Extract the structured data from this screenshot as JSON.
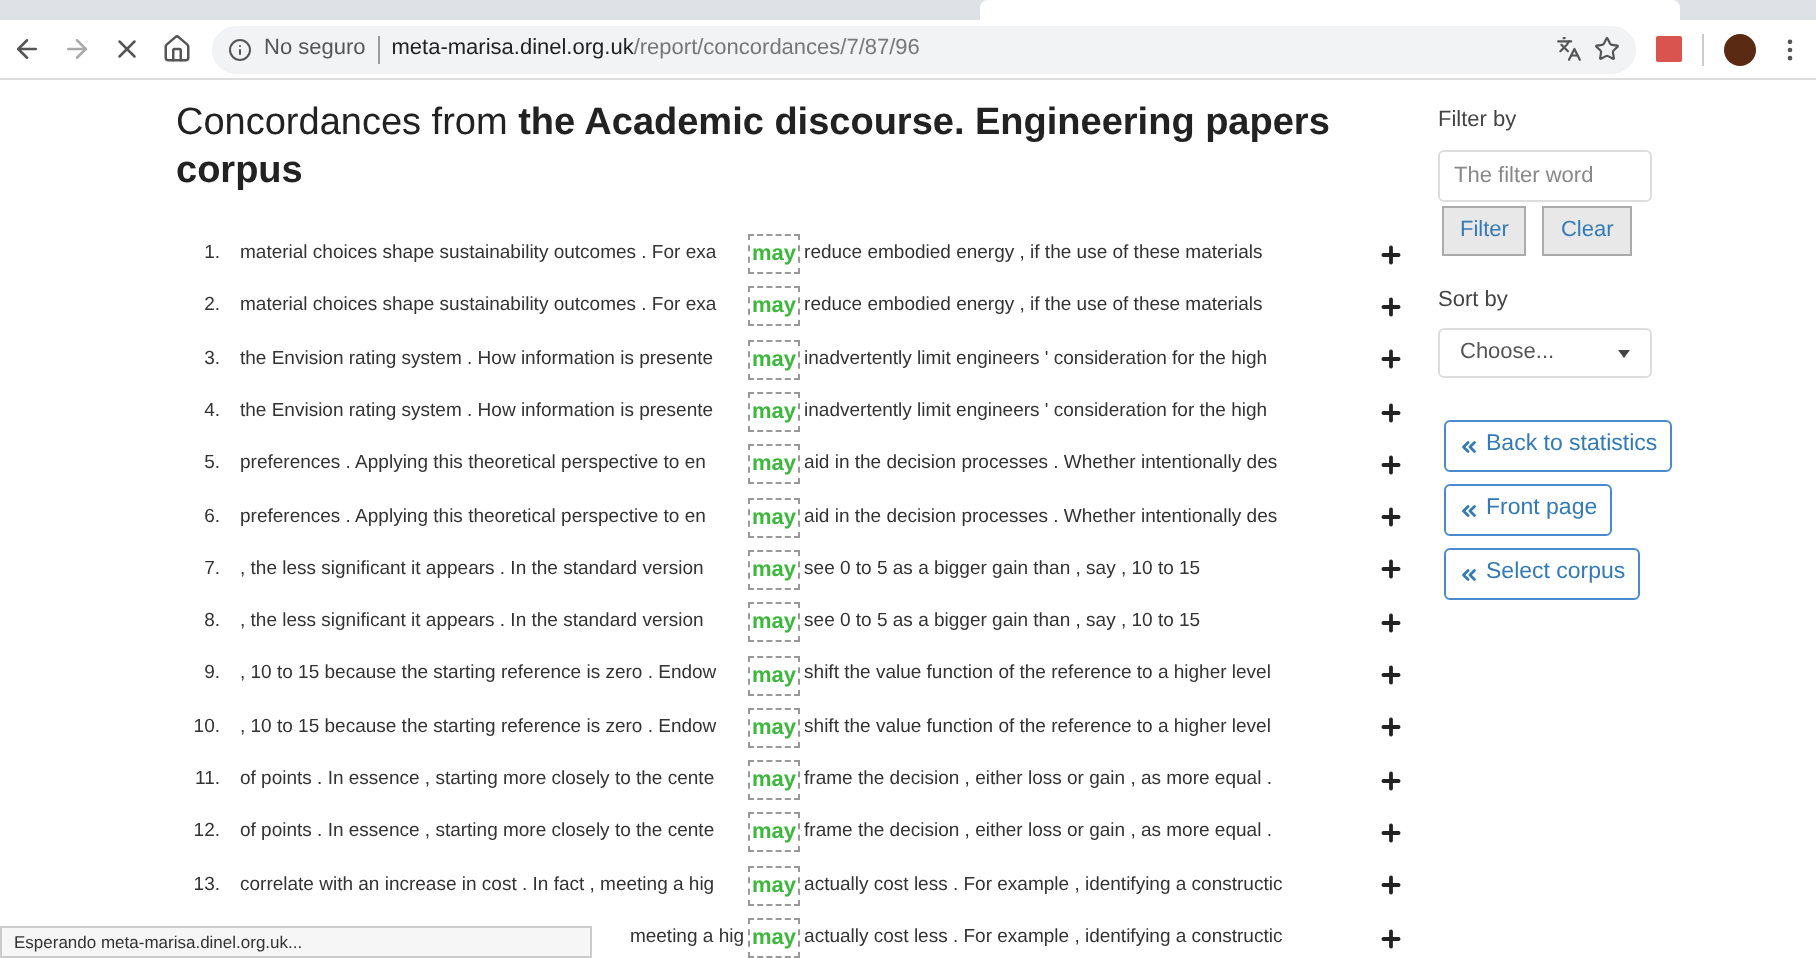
{
  "browser": {
    "security": "No seguro",
    "url_domain": "meta-marisa.dinel.org.uk",
    "url_path": "/report/concordances/7/87/96"
  },
  "title": "Concordances from **the Academic discourse. Engineering papers corpus**",
  "rows": [
    {
      "number": "1.",
      "left": "material choices shape sustainability outcomes . For exa",
      "keyword": "may",
      "right": "reduce embodied energy , if the use of these materials"
    },
    {
      "number": "2.",
      "left": "material choices shape sustainability outcomes . For exa",
      "keyword": "may",
      "right": "reduce embodied energy , if the use of these materials"
    },
    {
      "number": "3.",
      "left": "the Envision rating system . How information is presente",
      "keyword": "may",
      "right": "inadvertently limit engineers ' consideration for the high"
    },
    {
      "number": "4.",
      "left": "the Envision rating system . How information is presente",
      "keyword": "may",
      "right": "inadvertently limit engineers ' consideration for the high"
    },
    {
      "number": "5.",
      "left": "preferences . Applying this theoretical perspective to en",
      "keyword": "may",
      "right": "aid in the decision processes . Whether intentionally des"
    },
    {
      "number": "6.",
      "left": "preferences . Applying this theoretical perspective to en",
      "keyword": "may",
      "right": "aid in the decision processes . Whether intentionally des"
    },
    {
      "number": "7.",
      "left": ", the less significant it appears . In the standard version",
      "keyword": "may",
      "right": "see 0 to 5 as a bigger gain than , say , 10 to 15"
    },
    {
      "number": "8.",
      "left": ", the less significant it appears . In the standard version",
      "keyword": "may",
      "right": "see 0 to 5 as a bigger gain than , say , 10 to 15"
    },
    {
      "number": "9.",
      "left": ", 10 to 15 because the starting reference is zero . Endow",
      "keyword": "may",
      "right": "shift the value function of the reference to a higher level"
    },
    {
      "number": "10.",
      "left": ", 10 to 15 because the starting reference is zero . Endow",
      "keyword": "may",
      "right": "shift the value function of the reference to a higher level"
    },
    {
      "number": "11.",
      "left": "of points . In essence , starting more closely to the cente",
      "keyword": "may",
      "right": "frame the decision , either loss or gain , as more equal ."
    },
    {
      "number": "12.",
      "left": "of points . In essence , starting more closely to the cente",
      "keyword": "may",
      "right": "frame the decision , either loss or gain , as more equal ."
    },
    {
      "number": "13.",
      "left": "correlate with an increase in cost . In fact , meeting a hig",
      "keyword": "may",
      "right": "actually cost less . For example , identifying a constructic"
    },
    {
      "left": "meeting a hig",
      "keyword": "may",
      "right": "actually cost less . For example , identifying a constructic"
    }
  ],
  "sidebar": {
    "filter_label": "Filter by",
    "filter_placeholder": "The filter word",
    "filter_button": "Filter",
    "clear_button": "Clear",
    "sort_label": "Sort by",
    "sort_value": "Choose...",
    "links": [
      "Back to statistics",
      "Front page",
      "Select corpus"
    ]
  },
  "status_bar": "Esperando meta-marisa.dinel.org.uk..."
}
